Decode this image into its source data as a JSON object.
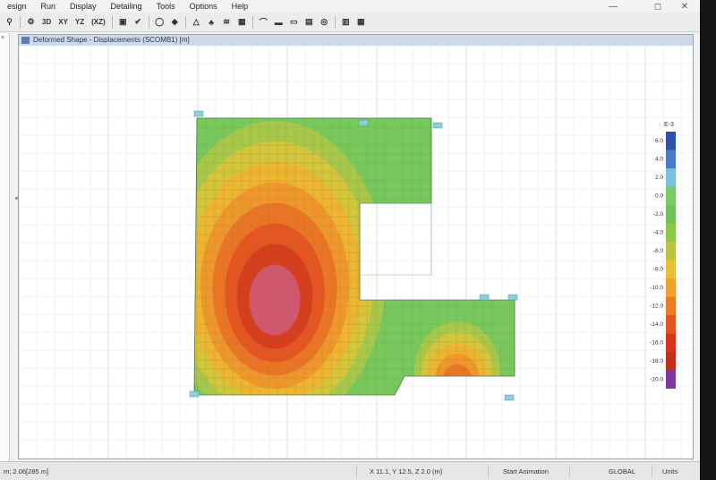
{
  "menu": {
    "items": [
      "esign",
      "Run",
      "Display",
      "Detailing",
      "Tools",
      "Options",
      "Help"
    ],
    "minimize": "—",
    "maximize": "◻",
    "close": "✕"
  },
  "toolbar": {
    "view_3d": "3D",
    "view_xy": "XY",
    "view_yz": "YZ",
    "view_xz": "(XZ)"
  },
  "window": {
    "title": "Deformed Shape - Displacements (SCOMB1) [m]"
  },
  "legend": {
    "unit": "E-3",
    "ticks": [
      "6.0",
      "4.0",
      "2.0",
      "0.0",
      "-2.0",
      "-4.0",
      "-6.0",
      "-8.0",
      "-10.0",
      "-12.0",
      "-14.0",
      "-16.0",
      "-18.0",
      "-20.0"
    ],
    "colors": [
      "#3050a8",
      "#4c7cc8",
      "#78c2dc",
      "#7cc86a",
      "#72c25a",
      "#8cc848",
      "#b8c640",
      "#e8c038",
      "#f0a030",
      "#ec7c24",
      "#e45420",
      "#d8331c",
      "#c0301c",
      "#7a3aa0"
    ]
  },
  "contour": {
    "base": "#78c85c",
    "cyan": "#78c8dc",
    "rings": [
      "#a9c84a",
      "#d6c43a",
      "#efb430",
      "#f0962a",
      "#ec7424",
      "#e85420",
      "#d83c1c",
      "#d4566e"
    ]
  },
  "status": {
    "left": "m; 2.06[285 m]",
    "coords": "X 11.1, Y 12.5, Z 2.0 (m)",
    "animation": "Start Animation",
    "global": "GLOBAL",
    "units": "Units"
  }
}
